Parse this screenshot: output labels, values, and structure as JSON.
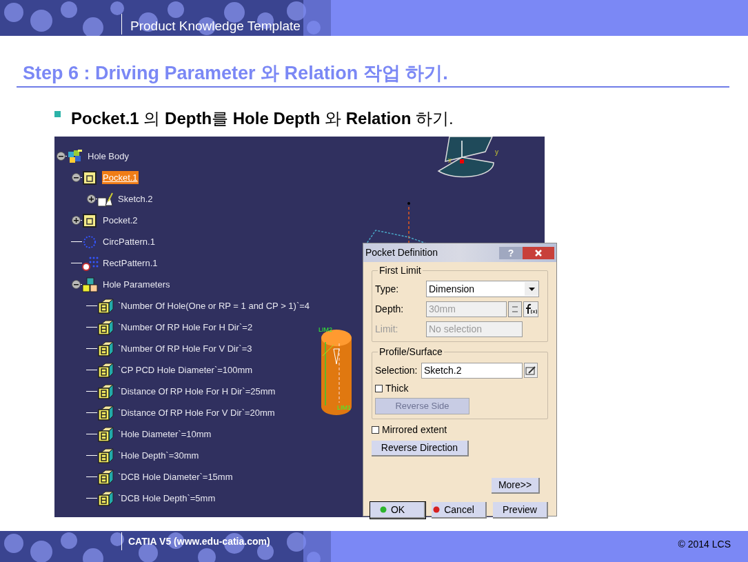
{
  "header": {
    "title": "Product Knowledge Template"
  },
  "slide_title": "Step 6 : Driving Parameter 와 Relation 작업 하기.",
  "bullet": "**Pocket.1** 의 **Depth**를 **Hole Depth** 와 **Relation** 하기.",
  "tree": [
    {
      "label": "Hole Body",
      "kind": "body",
      "selected": false,
      "expanded": true,
      "children": [
        {
          "label": "Pocket.1",
          "kind": "pocket",
          "selected": true,
          "expanded": true,
          "children": [
            {
              "label": "Sketch.2",
              "kind": "sketch",
              "selected": false,
              "expanded": false
            }
          ]
        },
        {
          "label": "Pocket.2",
          "kind": "pocket",
          "selected": false,
          "expanded": false
        },
        {
          "label": "CircPattern.1",
          "kind": "circpattern",
          "selected": false
        },
        {
          "label": "RectPattern.1",
          "kind": "rectpattern",
          "selected": false
        },
        {
          "label": "Hole Parameters",
          "kind": "parameters",
          "selected": false,
          "expanded": true,
          "children": [
            {
              "label": "`Number Of Hole(One or RP = 1 and CP > 1)`=4",
              "kind": "parameter",
              "selected": false
            },
            {
              "label": "`Number Of RP Hole For H Dir`=2",
              "kind": "parameter",
              "selected": false
            },
            {
              "label": "`Number Of RP Hole For V Dir`=3",
              "kind": "parameter",
              "selected": false
            },
            {
              "label": "`CP PCD Hole Diameter`=100mm",
              "kind": "parameter",
              "selected": false
            },
            {
              "label": "`Distance Of RP Hole For H Dir`=25mm",
              "kind": "parameter",
              "selected": false
            },
            {
              "label": "`Distance Of RP Hole For V Dir`=20mm",
              "kind": "parameter",
              "selected": false
            },
            {
              "label": "`Hole Diameter`=10mm",
              "kind": "parameter",
              "selected": false
            },
            {
              "label": "`Hole Depth`=30mm",
              "kind": "parameter",
              "selected": false
            },
            {
              "label": "`DCB Hole Diameter`=15mm",
              "kind": "parameter",
              "selected": false
            },
            {
              "label": "`DCB Hole Depth`=5mm",
              "kind": "parameter",
              "selected": false
            }
          ]
        }
      ]
    }
  ],
  "viewport": {
    "axis_labels": [
      "x",
      "y"
    ],
    "cylinder_labels": [
      "LIM2",
      "LIM1"
    ]
  },
  "dialog": {
    "title": "Pocket Definition",
    "help": "?",
    "first_limit": {
      "legend": "First Limit",
      "type_label": "Type:",
      "type_value": "Dimension",
      "depth_label": "Depth:",
      "depth_value": "30mm",
      "depth_disabled": true,
      "limit_label": "Limit:",
      "limit_value": "No selection",
      "limit_disabled": true
    },
    "profile": {
      "legend": "Profile/Surface",
      "selection_label": "Selection:",
      "selection_value": "Sketch.2",
      "thick_label": "Thick",
      "thick_checked": false,
      "reverse_side": "Reverse Side",
      "reverse_side_disabled": true
    },
    "mirrored_label": "Mirrored extent",
    "mirrored_checked": false,
    "reverse_direction": "Reverse Direction",
    "more": "More>>",
    "buttons": [
      {
        "label": "OK",
        "kind": "ok"
      },
      {
        "label": "Cancel",
        "kind": "cancel"
      },
      {
        "label": "Preview",
        "kind": "plain"
      }
    ]
  },
  "footer": {
    "left": "CATIA V5 (www.edu-catia.com)",
    "right": "© 2014 LCS"
  }
}
